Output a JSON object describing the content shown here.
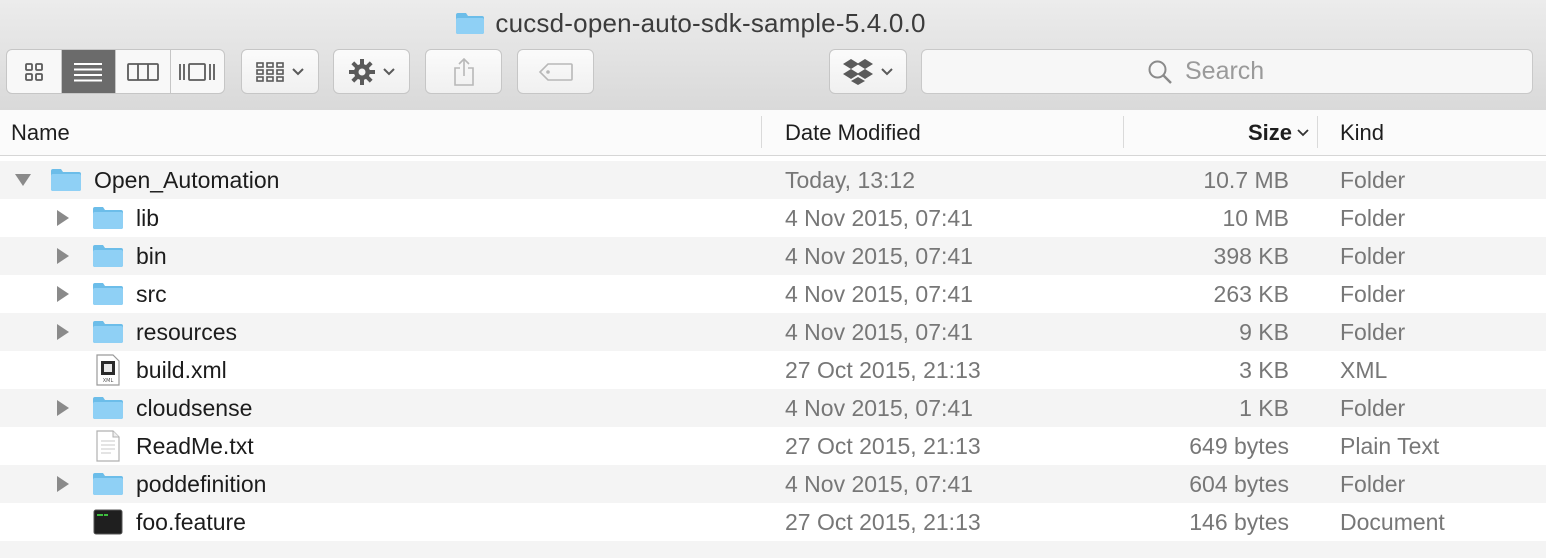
{
  "window": {
    "title": "cucsd-open-auto-sdk-sample-5.4.0.0"
  },
  "toolbar": {
    "views": [
      "icon-view",
      "list-view",
      "column-view",
      "cover-flow-view"
    ],
    "active_view": "list-view",
    "search": {
      "placeholder": "Search",
      "value": ""
    }
  },
  "columns": {
    "name": "Name",
    "date": "Date Modified",
    "size": "Size",
    "kind": "Kind"
  },
  "rows": [
    {
      "name": "Open_Automation",
      "date": "Today, 13:12",
      "size": "10.7 MB",
      "kind": "Folder",
      "icon": "folder-icon",
      "expanded": true,
      "depth": 0
    },
    {
      "name": "lib",
      "date": "4 Nov 2015, 07:41",
      "size": "10 MB",
      "kind": "Folder",
      "icon": "folder-icon",
      "expanded": false,
      "depth": 1
    },
    {
      "name": "bin",
      "date": "4 Nov 2015, 07:41",
      "size": "398 KB",
      "kind": "Folder",
      "icon": "folder-icon",
      "expanded": false,
      "depth": 1
    },
    {
      "name": "src",
      "date": "4 Nov 2015, 07:41",
      "size": "263 KB",
      "kind": "Folder",
      "icon": "folder-icon",
      "expanded": false,
      "depth": 1
    },
    {
      "name": "resources",
      "date": "4 Nov 2015, 07:41",
      "size": "9 KB",
      "kind": "Folder",
      "icon": "folder-icon",
      "expanded": false,
      "depth": 1
    },
    {
      "name": "build.xml",
      "date": "27 Oct 2015, 21:13",
      "size": "3 KB",
      "kind": "XML",
      "icon": "xml-file-icon",
      "depth": 1
    },
    {
      "name": "cloudsense",
      "date": "4 Nov 2015, 07:41",
      "size": "1 KB",
      "kind": "Folder",
      "icon": "folder-icon",
      "expanded": false,
      "depth": 1
    },
    {
      "name": "ReadMe.txt",
      "date": "27 Oct 2015, 21:13",
      "size": "649 bytes",
      "kind": "Plain Text",
      "icon": "text-file-icon",
      "depth": 1
    },
    {
      "name": "poddefinition",
      "date": "4 Nov 2015, 07:41",
      "size": "604 bytes",
      "kind": "Folder",
      "icon": "folder-icon",
      "expanded": false,
      "depth": 1
    },
    {
      "name": "foo.feature",
      "date": "27 Oct 2015, 21:13",
      "size": "146 bytes",
      "kind": "Document",
      "icon": "terminal-file-icon",
      "depth": 1
    }
  ],
  "colors": {
    "folder": "#8fd0f5",
    "folder_tab": "#6cbde9",
    "alt_row": "#f4f4f4",
    "secondary_text": "#777777",
    "active_segment": "#6b6b6b"
  }
}
